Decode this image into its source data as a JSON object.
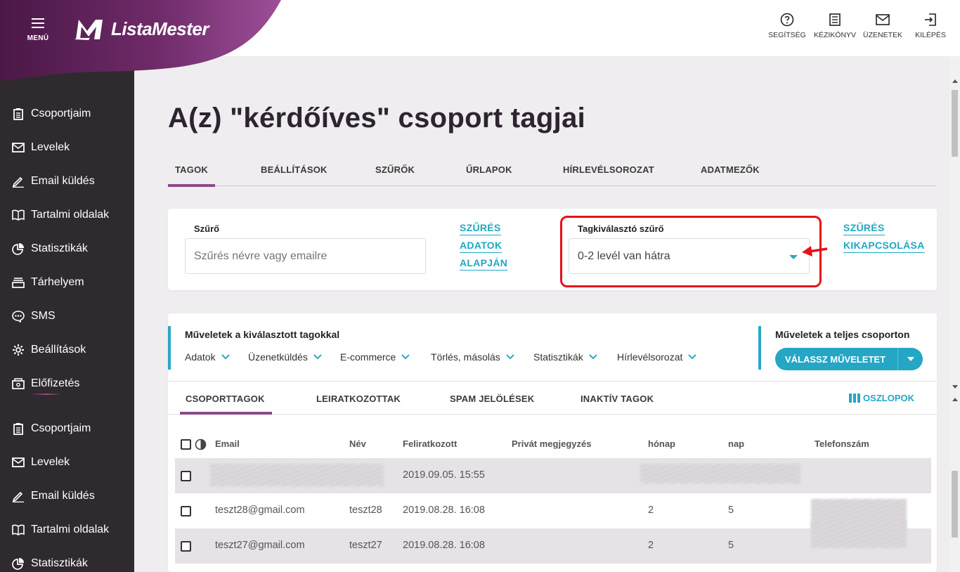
{
  "header": {
    "menu_label": "MENÜ",
    "logo_text": "ListaMester",
    "actions": [
      {
        "label": "SEGÍTSÉG",
        "icon": "help-icon"
      },
      {
        "label": "KÉZIKÖNYV",
        "icon": "manual-icon"
      },
      {
        "label": "ÜZENETEK",
        "icon": "mail-icon"
      },
      {
        "label": "KILÉPÉS",
        "icon": "logout-icon"
      }
    ]
  },
  "sidebar": {
    "items": [
      {
        "label": "Csoportjaim",
        "icon": "clipboard-icon"
      },
      {
        "label": "Levelek",
        "icon": "envelope-icon"
      },
      {
        "label": "Email küldés",
        "icon": "pencil-icon"
      },
      {
        "label": "Tartalmi oldalak",
        "icon": "book-icon"
      },
      {
        "label": "Statisztikák",
        "icon": "pie-chart-icon"
      },
      {
        "label": "Tárhelyem",
        "icon": "storage-icon"
      },
      {
        "label": "SMS",
        "icon": "sms-icon"
      },
      {
        "label": "Beállítások",
        "icon": "gear-icon"
      },
      {
        "label": "Előfizetés",
        "icon": "subscription-icon"
      },
      {
        "label": "Csoportjaim",
        "icon": "clipboard-icon"
      },
      {
        "label": "Levelek",
        "icon": "envelope-icon"
      },
      {
        "label": "Email küldés",
        "icon": "pencil-icon"
      },
      {
        "label": "Tartalmi oldalak",
        "icon": "book-icon"
      },
      {
        "label": "Statisztikák",
        "icon": "pie-chart-icon"
      }
    ]
  },
  "page": {
    "title": "A(z) \"kérdőíves\" csoport tagjai",
    "tabs": [
      "TAGOK",
      "BEÁLLÍTÁSOK",
      "SZŰRŐK",
      "ŰRLAPOK",
      "HÍRLEVÉLSOROZAT",
      "ADATMEZŐK"
    ],
    "active_tab": "TAGOK"
  },
  "filter": {
    "label": "Szűrő",
    "placeholder": "Szűrés névre vagy emailre",
    "filter_by_data": [
      "SZŰRÉS",
      "ADATOK",
      "ALAPJÁN"
    ],
    "selector_label": "Tagkiválasztó szűrő",
    "selector_value": "0-2 levél van hátra",
    "disable_filter": [
      "SZŰRÉS",
      "KIKAPCSOLÁSA"
    ]
  },
  "operations": {
    "selected_title": "Műveletek a kiválasztott tagokkal",
    "dropdowns": [
      "Adatok",
      "Üzenetküldés",
      "E-commerce",
      "Törlés, másolás",
      "Statisztikák",
      "Hírlevélsorozat"
    ],
    "group_title": "Műveletek a teljes csoporton",
    "group_button": "VÁLASSZ MŰVELETET"
  },
  "member_tabs": {
    "tabs": [
      "CSOPORTTAGOK",
      "LEIRATKOZOTTAK",
      "SPAM JELÖLÉSEK",
      "INAKTÍV TAGOK"
    ],
    "active": "CSOPORTTAGOK",
    "columns_button": "OSZLOPOK"
  },
  "table": {
    "headers": [
      "Email",
      "Név",
      "Feliratkozott",
      "Privát megjegyzés",
      "hónap",
      "nap",
      "Telefonszám"
    ],
    "rows": [
      {
        "email": "",
        "name": "",
        "subscribed": "2019.09.05. 15:55",
        "note": "",
        "month": "",
        "day": "",
        "phone": ""
      },
      {
        "email": "teszt28@gmail.com",
        "name": "teszt28",
        "subscribed": "2019.08.28. 16:08",
        "note": "",
        "month": "2",
        "day": "5",
        "phone": ""
      },
      {
        "email": "teszt27@gmail.com",
        "name": "teszt27",
        "subscribed": "2019.08.28. 16:08",
        "note": "",
        "month": "2",
        "day": "5",
        "phone": ""
      }
    ]
  },
  "colors": {
    "brand_purple": "#5a1d55",
    "accent_teal": "#25a6c5",
    "sidebar_bg": "#2f2a2e",
    "highlight_red": "#e8101a"
  }
}
